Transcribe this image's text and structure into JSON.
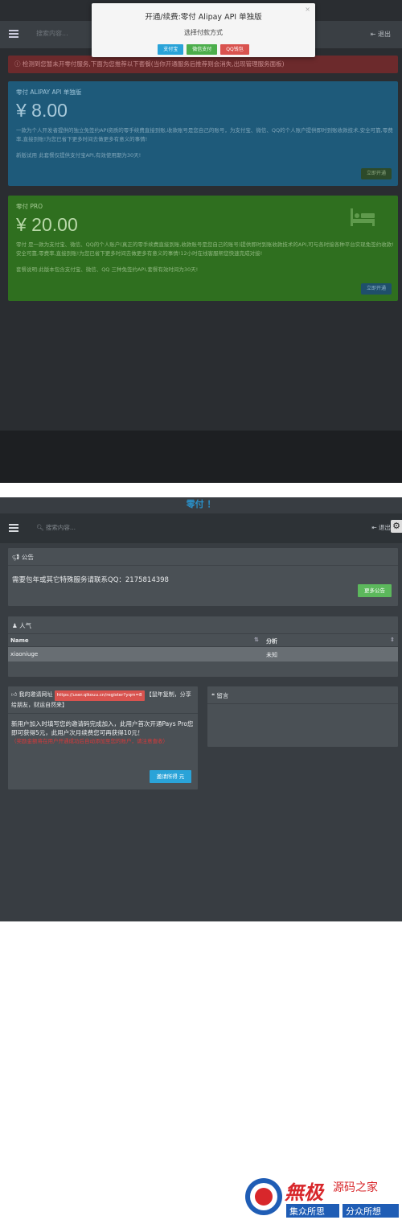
{
  "screen1": {
    "search_placeholder": "搜索内容...",
    "exit_label": "退出",
    "alert_text": "检测到您暂未开零付服务,下面为您推荐以下套餐(当你开通服务后推荐则会消失,出现管理服务面板)",
    "modal": {
      "title": "开通/续费:零付 Alipay API 单独版",
      "subtitle": "选择付款方式",
      "close": "×",
      "buttons": [
        "支付宝",
        "微信支付",
        "QQ钱包"
      ]
    },
    "plans": [
      {
        "name": "零付 ALIPAY API 单独版",
        "price": "¥ 8.00",
        "desc": "一款为个人开发者提供的独立免签约API资质的零手续费直接到账,收款账号是您自己的账号，为支付宝、微信、QQ的个人账户提供即时到账收款技术,安全可靠,零费率,直接到账!为您已省下更多时间去做更多有意义的事情!",
        "note": "新版试用 此套餐仅提供支付宝API,有效使用期为30天!",
        "button": "立即开通"
      },
      {
        "name": "零付 PRO",
        "price": "¥ 20.00",
        "desc": "零付 是一款为支付宝、微信、QQ的个人账户(真正的零手续费直接到账,收款账号是您自己的账号)提供即时到账收款技术的API,可与各时接各种平台实现免签约收款!安全可靠,零费率,直接到账!为您已省下更多时间去做更多有意义的事情!12小时在线客服帮您快速完成对接!",
        "note": "套餐说明:此版本包含支付宝、微信、QQ 三种免签约API,套餐有效时间为30天!",
        "button": "立即开通"
      }
    ]
  },
  "screen2": {
    "headline": "零付 ！",
    "search_placeholder": "搜索内容...",
    "exit_label": "退出",
    "notice": {
      "title": "公告",
      "body": "需要包年或其它特殊服务请联系QQ：2175814398",
      "button": "更多公告"
    },
    "popular": {
      "title": "人气",
      "columns": [
        "Name",
        "分析"
      ],
      "rows": [
        {
          "name": "xiaoniuge",
          "analysis": "未知"
        }
      ]
    },
    "invite": {
      "title_prefix": "我的邀请网址",
      "url": "https://user.qikouu.cn/register?yqm=8",
      "title_suffix": "【鼠年复制，分享给朋友，财运自然来】",
      "body": "新用户加入时填写您的邀请码完成加入，此用户首次开通Pays Pro您即可获得5元，此用户次月续费您可再获得10元！",
      "red_text": "（奖励金额将在用户开通成功后自动添加至您的账户，请注意查收）",
      "button": "邀请所得 元"
    },
    "message": {
      "title": "留言"
    }
  },
  "watermark": {
    "brand": "無极",
    "site": "源码之家",
    "slogan_left": "集众所思",
    "slogan_right": "分众所想"
  },
  "colors": {
    "accent_blue": "#2aa3d8",
    "success_green": "#5cb85c",
    "danger_red": "#d9534f",
    "headline_blue": "#2a8fc7"
  }
}
